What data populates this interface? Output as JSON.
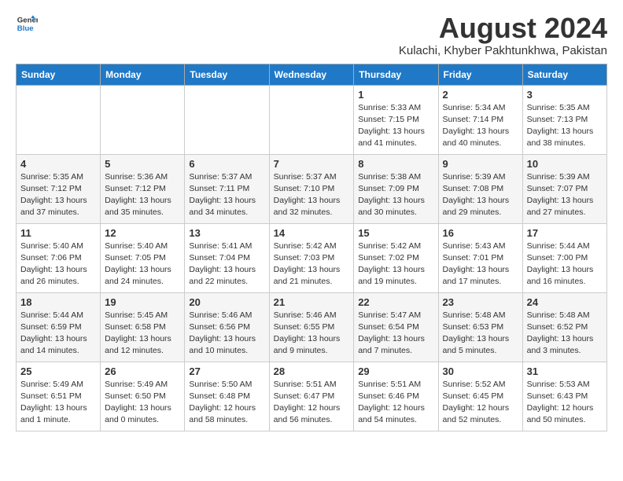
{
  "logo": {
    "line1": "General",
    "line2": "Blue"
  },
  "title": "August 2024",
  "location": "Kulachi, Khyber Pakhtunkhwa, Pakistan",
  "days_of_week": [
    "Sunday",
    "Monday",
    "Tuesday",
    "Wednesday",
    "Thursday",
    "Friday",
    "Saturday"
  ],
  "weeks": [
    [
      {
        "day": "",
        "info": ""
      },
      {
        "day": "",
        "info": ""
      },
      {
        "day": "",
        "info": ""
      },
      {
        "day": "",
        "info": ""
      },
      {
        "day": "1",
        "info": "Sunrise: 5:33 AM\nSunset: 7:15 PM\nDaylight: 13 hours\nand 41 minutes."
      },
      {
        "day": "2",
        "info": "Sunrise: 5:34 AM\nSunset: 7:14 PM\nDaylight: 13 hours\nand 40 minutes."
      },
      {
        "day": "3",
        "info": "Sunrise: 5:35 AM\nSunset: 7:13 PM\nDaylight: 13 hours\nand 38 minutes."
      }
    ],
    [
      {
        "day": "4",
        "info": "Sunrise: 5:35 AM\nSunset: 7:12 PM\nDaylight: 13 hours\nand 37 minutes."
      },
      {
        "day": "5",
        "info": "Sunrise: 5:36 AM\nSunset: 7:12 PM\nDaylight: 13 hours\nand 35 minutes."
      },
      {
        "day": "6",
        "info": "Sunrise: 5:37 AM\nSunset: 7:11 PM\nDaylight: 13 hours\nand 34 minutes."
      },
      {
        "day": "7",
        "info": "Sunrise: 5:37 AM\nSunset: 7:10 PM\nDaylight: 13 hours\nand 32 minutes."
      },
      {
        "day": "8",
        "info": "Sunrise: 5:38 AM\nSunset: 7:09 PM\nDaylight: 13 hours\nand 30 minutes."
      },
      {
        "day": "9",
        "info": "Sunrise: 5:39 AM\nSunset: 7:08 PM\nDaylight: 13 hours\nand 29 minutes."
      },
      {
        "day": "10",
        "info": "Sunrise: 5:39 AM\nSunset: 7:07 PM\nDaylight: 13 hours\nand 27 minutes."
      }
    ],
    [
      {
        "day": "11",
        "info": "Sunrise: 5:40 AM\nSunset: 7:06 PM\nDaylight: 13 hours\nand 26 minutes."
      },
      {
        "day": "12",
        "info": "Sunrise: 5:40 AM\nSunset: 7:05 PM\nDaylight: 13 hours\nand 24 minutes."
      },
      {
        "day": "13",
        "info": "Sunrise: 5:41 AM\nSunset: 7:04 PM\nDaylight: 13 hours\nand 22 minutes."
      },
      {
        "day": "14",
        "info": "Sunrise: 5:42 AM\nSunset: 7:03 PM\nDaylight: 13 hours\nand 21 minutes."
      },
      {
        "day": "15",
        "info": "Sunrise: 5:42 AM\nSunset: 7:02 PM\nDaylight: 13 hours\nand 19 minutes."
      },
      {
        "day": "16",
        "info": "Sunrise: 5:43 AM\nSunset: 7:01 PM\nDaylight: 13 hours\nand 17 minutes."
      },
      {
        "day": "17",
        "info": "Sunrise: 5:44 AM\nSunset: 7:00 PM\nDaylight: 13 hours\nand 16 minutes."
      }
    ],
    [
      {
        "day": "18",
        "info": "Sunrise: 5:44 AM\nSunset: 6:59 PM\nDaylight: 13 hours\nand 14 minutes."
      },
      {
        "day": "19",
        "info": "Sunrise: 5:45 AM\nSunset: 6:58 PM\nDaylight: 13 hours\nand 12 minutes."
      },
      {
        "day": "20",
        "info": "Sunrise: 5:46 AM\nSunset: 6:56 PM\nDaylight: 13 hours\nand 10 minutes."
      },
      {
        "day": "21",
        "info": "Sunrise: 5:46 AM\nSunset: 6:55 PM\nDaylight: 13 hours\nand 9 minutes."
      },
      {
        "day": "22",
        "info": "Sunrise: 5:47 AM\nSunset: 6:54 PM\nDaylight: 13 hours\nand 7 minutes."
      },
      {
        "day": "23",
        "info": "Sunrise: 5:48 AM\nSunset: 6:53 PM\nDaylight: 13 hours\nand 5 minutes."
      },
      {
        "day": "24",
        "info": "Sunrise: 5:48 AM\nSunset: 6:52 PM\nDaylight: 13 hours\nand 3 minutes."
      }
    ],
    [
      {
        "day": "25",
        "info": "Sunrise: 5:49 AM\nSunset: 6:51 PM\nDaylight: 13 hours\nand 1 minute."
      },
      {
        "day": "26",
        "info": "Sunrise: 5:49 AM\nSunset: 6:50 PM\nDaylight: 13 hours\nand 0 minutes."
      },
      {
        "day": "27",
        "info": "Sunrise: 5:50 AM\nSunset: 6:48 PM\nDaylight: 12 hours\nand 58 minutes."
      },
      {
        "day": "28",
        "info": "Sunrise: 5:51 AM\nSunset: 6:47 PM\nDaylight: 12 hours\nand 56 minutes."
      },
      {
        "day": "29",
        "info": "Sunrise: 5:51 AM\nSunset: 6:46 PM\nDaylight: 12 hours\nand 54 minutes."
      },
      {
        "day": "30",
        "info": "Sunrise: 5:52 AM\nSunset: 6:45 PM\nDaylight: 12 hours\nand 52 minutes."
      },
      {
        "day": "31",
        "info": "Sunrise: 5:53 AM\nSunset: 6:43 PM\nDaylight: 12 hours\nand 50 minutes."
      }
    ]
  ]
}
